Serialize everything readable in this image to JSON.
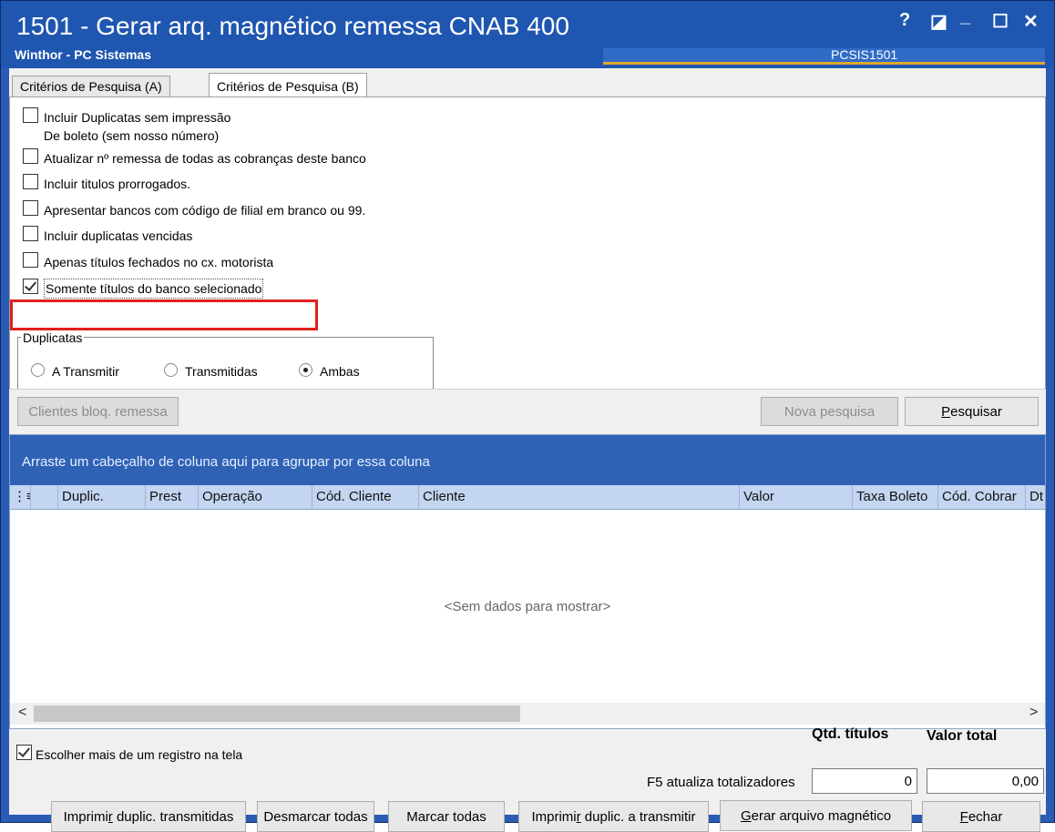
{
  "window": {
    "title": "1501 - Gerar arq. magnético remessa CNAB 400",
    "subtitle": "Winthor - PC Sistemas",
    "routine_code": "PCSIS1501",
    "help_glyph": "?",
    "restore_glyph": "◪",
    "minimize_glyph": "_",
    "maximize_glyph": "☐",
    "close_glyph": "✕"
  },
  "tabs": [
    {
      "label": "Critérios de Pesquisa (A)"
    },
    {
      "label": "Critérios de Pesquisa (B)"
    }
  ],
  "criteria": {
    "checkboxes": [
      {
        "label_line1": "Incluir Duplicatas sem impressão",
        "label_line2": "De boleto (sem nosso número)",
        "checked": false
      },
      {
        "label": "Atualizar nº remessa de todas as cobranças deste banco",
        "checked": false
      },
      {
        "label": "Incluir titulos prorrogados.",
        "checked": false
      },
      {
        "label": "Apresentar bancos com código de filial em branco ou 99.",
        "checked": false
      },
      {
        "label": "Incluir duplicatas vencidas",
        "checked": false
      },
      {
        "label": "Apenas títulos fechados no cx. motorista",
        "checked": false
      },
      {
        "label": "Somente títulos do banco selecionado",
        "checked": true
      }
    ],
    "duplicatas": {
      "title": "Duplicatas",
      "options": [
        "A Transmitir",
        "Transmitidas",
        "Ambas"
      ],
      "selected": "Ambas"
    }
  },
  "actions": {
    "clientes_bloq": "Clientes bloq. remessa",
    "nova_pesquisa": "Nova pesquisa",
    "pesquisar_prefix": "P",
    "pesquisar_rest": "esquisar"
  },
  "grid": {
    "group_hint": "Arraste um cabeçalho de coluna aqui para agrupar por essa coluna",
    "columns": [
      "Duplic.",
      "Prest",
      "Operação",
      "Cód. Cliente",
      "Cliente",
      "Valor",
      "Taxa Boleto",
      "Cód. Cobrar",
      "Dt"
    ],
    "empty_message": "<Sem dados para mostrar>",
    "scroll_left": "<",
    "scroll_right": ">"
  },
  "footer": {
    "multi_select_label": "Escolher mais de um registro na tela",
    "multi_select_checked": true,
    "f5_label": "F5 atualiza totalizadores",
    "qtd_titulos_label": "Qtd. títulos",
    "qtd_titulos_value": "0",
    "valor_total_label": "Valor total",
    "valor_total_value": "0,00",
    "buttons": {
      "imprimir_transmitidas_a": "Imprimi",
      "imprimir_transmitidas_u": "r",
      "imprimir_transmitidas_b": " duplic. transmitidas",
      "desmarcar_todas": "Desmarcar todas",
      "marcar_todas": "Marcar todas",
      "imprimir_a_transmitir_a": "Imprimi",
      "imprimir_a_transmitir_u": "r",
      "imprimir_a_transmitir_b": " duplic. a transmitir",
      "gerar_u": "G",
      "gerar_rest": "erar arquivo magnético",
      "fechar_u": "F",
      "fechar_rest": "echar"
    }
  }
}
